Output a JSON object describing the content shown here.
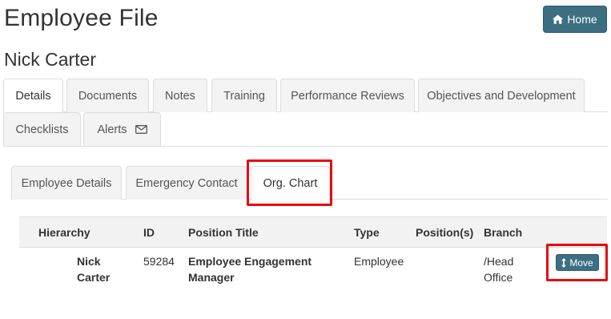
{
  "page": {
    "title": "Employee File",
    "employee_name": "Nick Carter"
  },
  "header": {
    "home_label": "Home",
    "home_icon": "home-icon"
  },
  "tabs": [
    {
      "label": "Details",
      "active": true
    },
    {
      "label": "Documents",
      "active": false
    },
    {
      "label": "Notes",
      "active": false
    },
    {
      "label": "Training",
      "active": false
    },
    {
      "label": "Performance Reviews",
      "active": false
    },
    {
      "label": "Objectives and Development",
      "active": false
    },
    {
      "label": "Checklists",
      "active": false
    },
    {
      "label": "Alerts",
      "active": false,
      "icon": "envelope-icon"
    }
  ],
  "subtabs": [
    {
      "label": "Employee Details",
      "active": false
    },
    {
      "label": "Emergency Contact",
      "active": false
    },
    {
      "label": "Org. Chart",
      "active": true
    }
  ],
  "table": {
    "columns": [
      "Hierarchy",
      "ID",
      "Position Title",
      "Type",
      "Position(s)",
      "Branch"
    ],
    "rows": [
      {
        "hierarchy_line1": "Nick",
        "hierarchy_line2": "Carter",
        "id": "59284",
        "position_title_line1": "Employee Engagement",
        "position_title_line2": "Manager",
        "type": "Employee",
        "positions": "",
        "branch_line1": "/Head",
        "branch_line2": "Office",
        "action_label": "Move",
        "action_icon": "vertical-arrows-icon"
      }
    ]
  },
  "colors": {
    "primary_button": "#3d6f83",
    "highlight": "#e8090f"
  }
}
